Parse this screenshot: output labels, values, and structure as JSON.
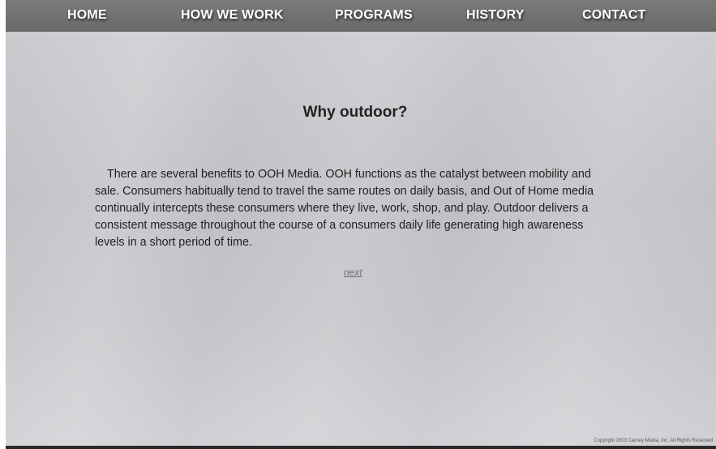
{
  "nav": {
    "items": [
      {
        "label": "HOME"
      },
      {
        "label": "HOW WE WORK"
      },
      {
        "label": "PROGRAMS"
      },
      {
        "label": "HISTORY"
      },
      {
        "label": "CONTACT"
      }
    ]
  },
  "main": {
    "title": "Why outdoor?",
    "body": "There are several benefits to OOH Media. OOH functions as the catalyst between mobility and sale. Consumers habitually tend to travel the same routes on daily basis, and Out of Home media continually intercepts these consumers where they live, work, shop, and play. Outdoor delivers a consistent message throughout the course of a consumers daily life generating high awareness levels in a short period of time.",
    "next_label": "next"
  },
  "footer": {
    "copyright": "Copyright  2003  Carney Media, Inc.   All Rights Reserved"
  },
  "colors": {
    "navbar": "#707070",
    "background": "#c4c5c8",
    "text": "#222222"
  }
}
